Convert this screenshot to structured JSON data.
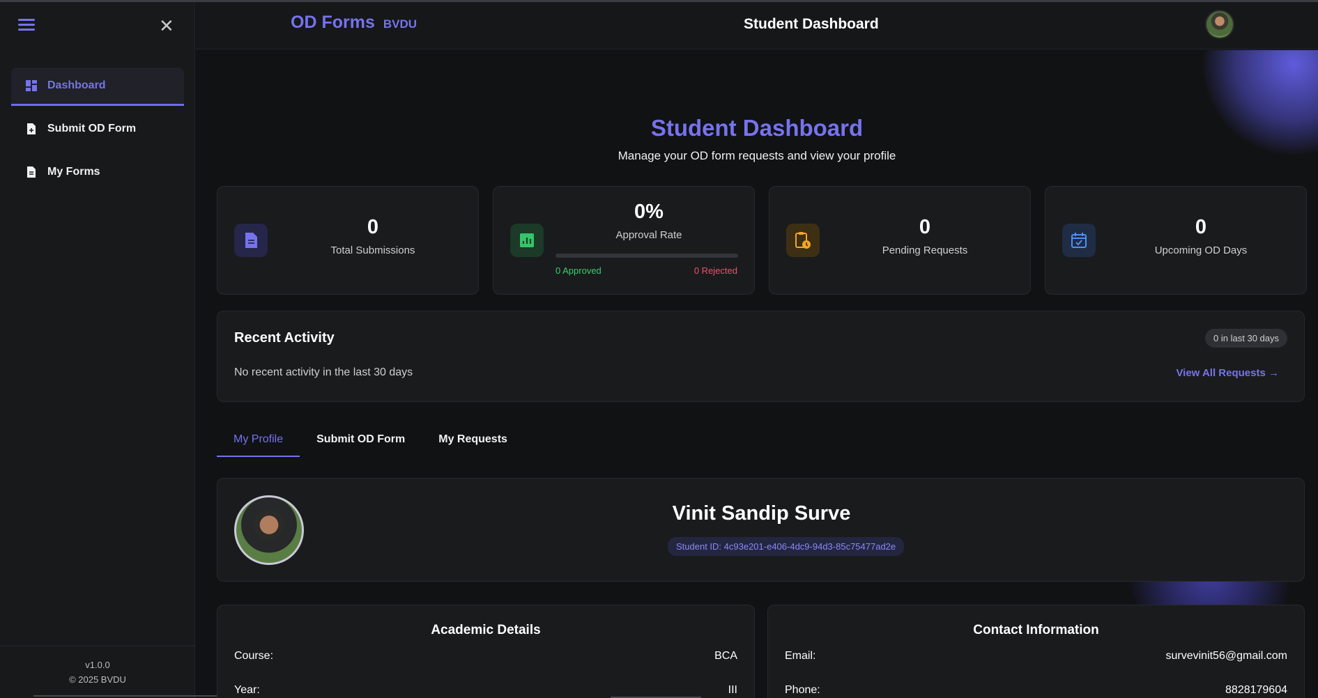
{
  "header": {
    "brand_name": "OD Forms",
    "brand_sub": "BVDU",
    "title": "Student Dashboard"
  },
  "sidebar": {
    "items": [
      {
        "label": "Dashboard",
        "icon": "dashboard-icon",
        "active": true
      },
      {
        "label": "Submit OD Form",
        "icon": "file-add-icon",
        "active": false
      },
      {
        "label": "My Forms",
        "icon": "file-icon",
        "active": false
      }
    ],
    "version": "v1.0.0",
    "copyright": "© 2025 BVDU"
  },
  "page": {
    "title": "Student Dashboard",
    "subtitle": "Manage your OD form requests and view your profile"
  },
  "stats": {
    "total": {
      "value": "0",
      "label": "Total Submissions"
    },
    "approval": {
      "value": "0%",
      "label": "Approval Rate",
      "approved": "0 Approved",
      "rejected": "0 Rejected",
      "fill_fraction": 0
    },
    "pending": {
      "value": "0",
      "label": "Pending Requests"
    },
    "upcoming": {
      "value": "0",
      "label": "Upcoming OD Days"
    }
  },
  "activity": {
    "title": "Recent Activity",
    "badge": "0 in last 30 days",
    "empty": "No recent activity in the last 30 days",
    "link": "View All Requests"
  },
  "tabs": [
    {
      "label": "My Profile",
      "active": true
    },
    {
      "label": "Submit OD Form",
      "active": false
    },
    {
      "label": "My Requests",
      "active": false
    }
  ],
  "profile": {
    "name": "Vinit Sandip Surve",
    "student_id": "Student ID: 4c93e201-e406-4dc9-94d3-85c75477ad2e"
  },
  "academic": {
    "title": "Academic Details",
    "course_label": "Course:",
    "course_value": "BCA",
    "year_label": "Year:",
    "year_value": "III"
  },
  "contact": {
    "title": "Contact Information",
    "email_label": "Email:",
    "email_value": "survevinit56@gmail.com",
    "phone_label": "Phone:",
    "phone_value": "8828179604"
  },
  "colors": {
    "accent": "#7673ee",
    "approved": "#3ccf6e",
    "rejected": "#f0526b",
    "pending": "#f5a524",
    "background": "#111214"
  }
}
